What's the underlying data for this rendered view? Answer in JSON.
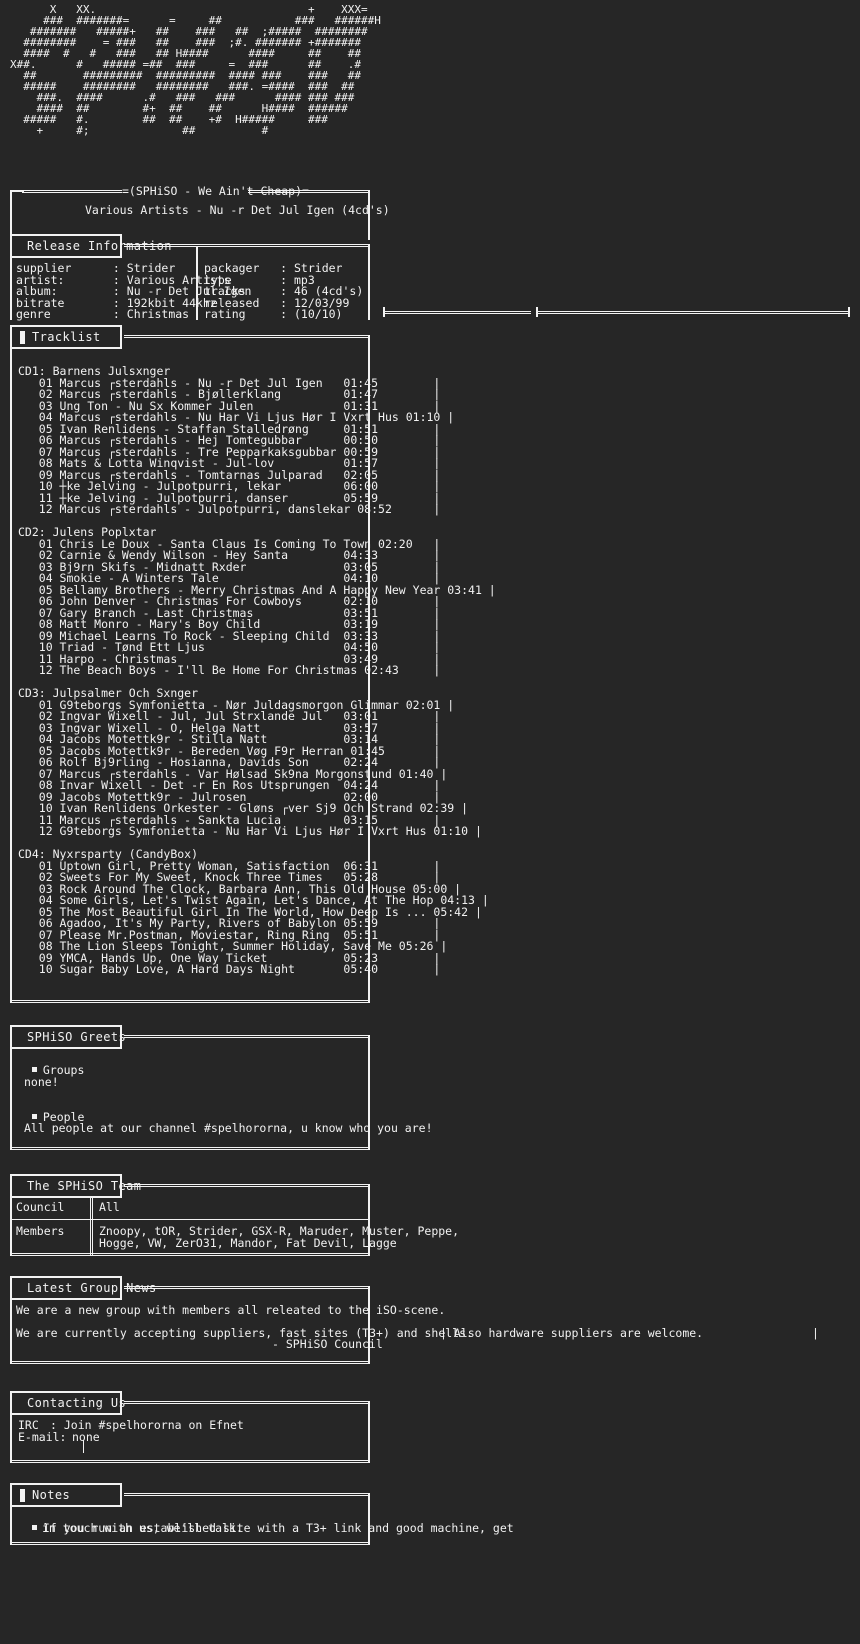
{
  "logo": {
    "art": "      X   XX.                                +    XXX=\n     ###  #######=      =     ##           ###   ######H\n   #######   #####+   ##    ###   ##  ;#####  ########\n  ########    = ###   ##    ###  ;#. ####### +#######\n  ####  #   #   ###   ## H####      ####     ##    ##\nX##.      #   ##### =##  ###     =  ###      ##    .#\n  ##       #########  #########  #### ###    ###   ##\n  #####    ########   ########   ###. =####  ###  ##\n    ###.  ####      .#   ###   ###      #### ### ###\n    ####  ##        #+  ##    ##      H####  ######\n  #####   #.        ##  ##    +#  H#####     ###\n    +     #;              ##          #"
  },
  "header": {
    "group_tag": "=(SPHiSO - We Ain't Cheap)=",
    "release_title": "Various Artists - Nu -r Det Jul Igen (4cd's)"
  },
  "release_information": {
    "tab": "Release Information",
    "left": [
      {
        "key": "supplier",
        "sep": ":",
        "value": "Strider"
      },
      {
        "key": "artist:",
        "sep": ":",
        "value": "Various Artists"
      },
      {
        "key": "album:",
        "sep": ":",
        "value": "Nu -r Det Jul Igen"
      },
      {
        "key": "bitrate",
        "sep": ":",
        "value": "192kbit 44khz"
      },
      {
        "key": "genre",
        "sep": ":",
        "value": "Christmas"
      }
    ],
    "right": [
      {
        "key": "packager",
        "sep": ":",
        "value": "Strider"
      },
      {
        "key": "type",
        "sep": ":",
        "value": "mp3"
      },
      {
        "key": "tracks",
        "sep": ":",
        "value": "46 (4cd's)"
      },
      {
        "key": "released",
        "sep": ":",
        "value": "12/03/99"
      },
      {
        "key": "rating",
        "sep": ":",
        "value": "(10/10)"
      }
    ]
  },
  "tracklist": {
    "tab": "Tracklist",
    "discs": [
      {
        "title": "CD1: Barnens Julsxnger",
        "tracks": [
          {
            "no": "01",
            "name": "Marcus ┌sterdahls - Nu -r Det Jul Igen",
            "time": "01:45"
          },
          {
            "no": "02",
            "name": "Marcus ┌sterdahls - Bjøllerklang",
            "time": "01:47"
          },
          {
            "no": "03",
            "name": "Ung Ton - Nu Sx Kommer Julen",
            "time": "01:31"
          },
          {
            "no": "04",
            "name": "Marcus ┌sterdahls - Nu Har Vi Ljus Hør I Vxrt Hus",
            "time": "01:10"
          },
          {
            "no": "05",
            "name": "Ivan Renlidens - Staffan Stalledrøng",
            "time": "01:51"
          },
          {
            "no": "06",
            "name": "Marcus ┌sterdahls - Hej Tomtegubbar",
            "time": "00:50"
          },
          {
            "no": "07",
            "name": "Marcus ┌sterdahls - Tre Pepparkaksgubbar",
            "time": "00:59"
          },
          {
            "no": "08",
            "name": "Mats & Lotta Winqvist - Jul-lov",
            "time": "01:57"
          },
          {
            "no": "09",
            "name": "Marcus ┌sterdahls - Tomtarnas Julparad",
            "time": "02:05"
          },
          {
            "no": "10",
            "name": "┼ke Jelving - Julpotpurri, lekar",
            "time": "06:00"
          },
          {
            "no": "11",
            "name": "┼ke Jelving - Julpotpurri, danser",
            "time": "05:59"
          },
          {
            "no": "12",
            "name": "Marcus ┌sterdahls - Julpotpurri, danslekar",
            "time": "08:52"
          }
        ]
      },
      {
        "title": "CD2: Julens Poplxtar",
        "tracks": [
          {
            "no": "01",
            "name": "Chris Le Doux - Santa Claus Is Coming To Town",
            "time": "02:20"
          },
          {
            "no": "02",
            "name": "Carnie & Wendy Wilson - Hey Santa",
            "time": "04:33"
          },
          {
            "no": "03",
            "name": "Bj9rn Skifs - Midnatt Rxder",
            "time": "03:05"
          },
          {
            "no": "04",
            "name": "Smokie - A Winters Tale",
            "time": "04:10"
          },
          {
            "no": "05",
            "name": "Bellamy Brothers - Merry Christmas And A Happy New Year",
            "time": "03:41"
          },
          {
            "no": "06",
            "name": "John Denver - Christmas For Cowboys",
            "time": "02:10"
          },
          {
            "no": "07",
            "name": "Gary Branch - Last Christmas",
            "time": "03:51"
          },
          {
            "no": "08",
            "name": "Matt Monro - Mary's Boy Child",
            "time": "03:19"
          },
          {
            "no": "09",
            "name": "Michael Learns To Rock - Sleeping Child",
            "time": "03:33"
          },
          {
            "no": "10",
            "name": "Triad - Tønd Ett Ljus",
            "time": "04:50"
          },
          {
            "no": "11",
            "name": "Harpo - Christmas",
            "time": "03:49"
          },
          {
            "no": "12",
            "name": "The Beach Boys - I'll Be Home For Christmas",
            "time": "02:43"
          }
        ]
      },
      {
        "title": "CD3: Julpsalmer Och Sxnger",
        "tracks": [
          {
            "no": "01",
            "name": "G9teborgs Symfonietta - Nør Juldagsmorgon Glimmar",
            "time": "02:01"
          },
          {
            "no": "02",
            "name": "Ingvar Wixell - Jul, Jul Strxlande Jul",
            "time": "03:01"
          },
          {
            "no": "03",
            "name": "Ingvar Wixell - O, Helga Natt",
            "time": "03:57"
          },
          {
            "no": "04",
            "name": "Jacobs Motettk9r - Stilla Natt",
            "time": "03:14"
          },
          {
            "no": "05",
            "name": "Jacobs Motettk9r - Bereden Vøg F9r Herran",
            "time": "01:45"
          },
          {
            "no": "06",
            "name": "Rolf Bj9rling - Hosianna, Davids Son",
            "time": "02:24"
          },
          {
            "no": "07",
            "name": "Marcus ┌sterdahls - Var Hølsad Sk9na Morgonstund",
            "time": "01:40"
          },
          {
            "no": "08",
            "name": "Invar Wixell - Det -r En Ros Utsprungen",
            "time": "04:24"
          },
          {
            "no": "09",
            "name": "Jacobs Motettk9r - Julrosen",
            "time": "02:00"
          },
          {
            "no": "10",
            "name": "Ivan Renlidens Orkester - Gløns ┌ver Sj9 Och Strand",
            "time": "02:39"
          },
          {
            "no": "11",
            "name": "Marcus ┌sterdahls - Sankta Lucia",
            "time": "03:15"
          },
          {
            "no": "12",
            "name": "G9teborgs Symfonietta - Nu Har Vi Ljus Hør I Vxrt Hus",
            "time": "01:10"
          }
        ]
      },
      {
        "title": "CD4: Nyxrsparty (CandyBox)",
        "tracks": [
          {
            "no": "01",
            "name": "Uptown Girl, Pretty Woman, Satisfaction",
            "time": "06:31"
          },
          {
            "no": "02",
            "name": "Sweets For My Sweet, Knock Three Times",
            "time": "05:28"
          },
          {
            "no": "03",
            "name": "Rock Around The Clock, Barbara Ann, This Old House",
            "time": "05:00"
          },
          {
            "no": "04",
            "name": "Some Girls, Let's Twist Again, Let's Dance, At The Hop",
            "time": "04:13"
          },
          {
            "no": "05",
            "name": "The Most Beautiful Girl In The World, How Deep Is ...",
            "time": "05:42"
          },
          {
            "no": "06",
            "name": "Agadoo, It's My Party, Rivers of Babylon",
            "time": "05:59"
          },
          {
            "no": "07",
            "name": "Please Mr.Postman, Moviestar, Ring Ring",
            "time": "05:51"
          },
          {
            "no": "08",
            "name": "The Lion Sleeps Tonight, Summer Holiday, Save Me",
            "time": "05:26"
          },
          {
            "no": "09",
            "name": "YMCA, Hands Up, One Way Ticket",
            "time": "05:23"
          },
          {
            "no": "10",
            "name": "Sugar Baby Love, A Hard Days Night",
            "time": "05:40"
          }
        ]
      }
    ]
  },
  "greets": {
    "tab": "SPHiSO Greets",
    "groups_label": "Groups",
    "groups_value": "none!",
    "people_label": "People",
    "people_value": "All people at our channel #spelhororna, u know who you are!"
  },
  "team": {
    "tab": "The SPHiSO Team",
    "rows": [
      {
        "role": "Council",
        "value": "All"
      },
      {
        "role": "Members",
        "value": "Znoopy, tOR, Strider, GSX-R, Maruder, Muster, Peppe,\nHogge, VW, ZerO31, Mandor, Fat Devil, Lagge"
      }
    ]
  },
  "news": {
    "tab": "Latest Group News",
    "line1": "We are a new group with members all releated to the iSO-scene.",
    "line2": "We are currently accepting suppliers, fast sites (T3+) and shells.",
    "signature": "- SPHiSO Council"
  },
  "contact": {
    "tab": "Contacting Us",
    "irc_label": "IRC",
    "irc_value": ": Join #spelhororna on Efnet",
    "email_label": "E-mail:",
    "email_value": "none"
  },
  "notes": {
    "tab": "Notes",
    "line1": "If you run an established site with a T3+ link and good machine, get",
    "line2": "in touch with us, we'll talk."
  },
  "side_note": {
    "text": "| Also hardware suppliers are welcome.",
    "trailing": "|"
  }
}
